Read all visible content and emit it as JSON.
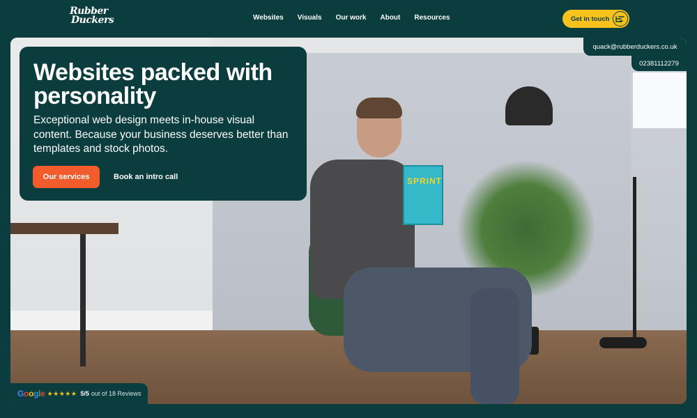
{
  "header": {
    "logo": {
      "line1": "Rubber",
      "line2": "Duckers"
    },
    "nav": [
      {
        "label": "Websites"
      },
      {
        "label": "Visuals"
      },
      {
        "label": "Our work"
      },
      {
        "label": "About"
      },
      {
        "label": "Resources"
      }
    ],
    "cta": {
      "label": "Get in touch",
      "icon": "hand-pointer-icon"
    }
  },
  "hero": {
    "title": "Websites packed with personality",
    "subtitle": "Exceptional web design meets in-house visual content. Because your business deserves better than templates and stock photos.",
    "primary_button": "Our services",
    "secondary_link": "Book an intro call",
    "book_title": "SPRINT"
  },
  "contact": {
    "email": "quack@rubberduckers.co.uk",
    "phone": "02381112279"
  },
  "reviews": {
    "provider": "Google",
    "stars": "★★★★★",
    "rating": "5/5",
    "text": "out of 18 Reviews"
  },
  "colors": {
    "brand_dark": "#0b3d3f",
    "cta_yellow": "#f6c21b",
    "primary_orange": "#f25c2b"
  }
}
